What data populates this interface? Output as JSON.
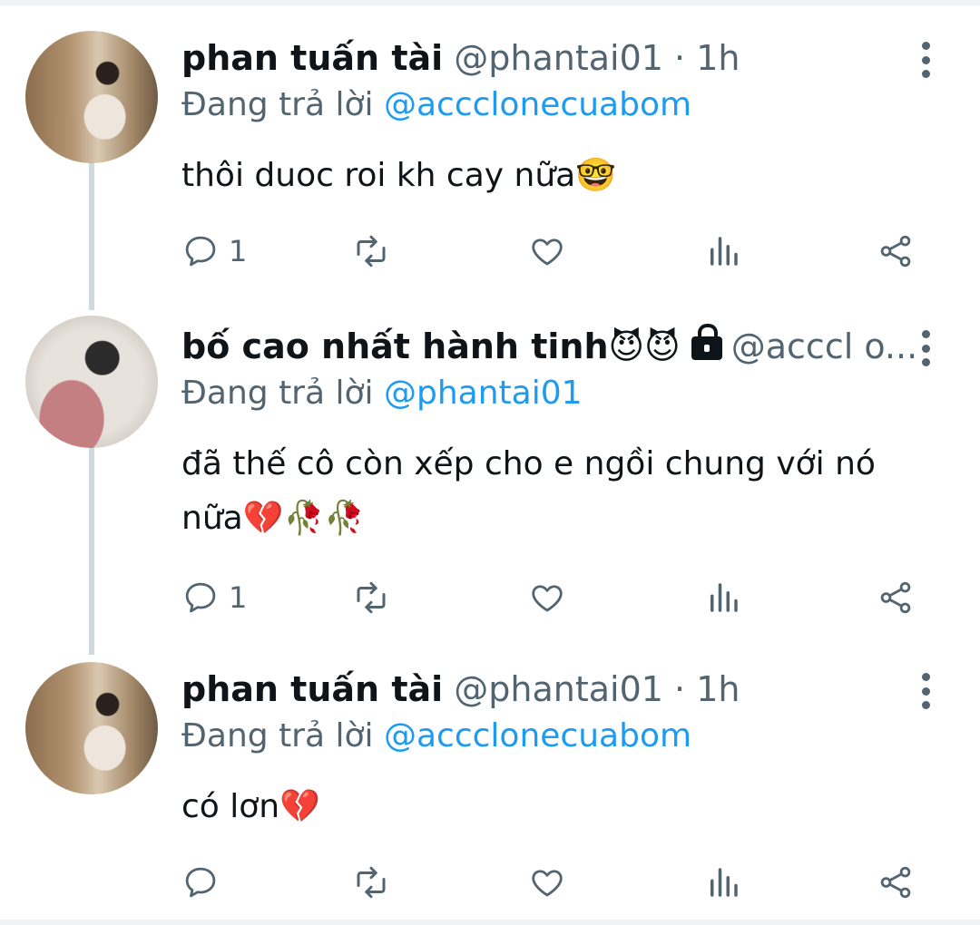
{
  "tweets": [
    {
      "name": "phan tuấn tài",
      "handle": "@phantai01",
      "dot": "·",
      "time": "1h",
      "reply_prefix": "Đang trả lời",
      "reply_to": "@accclonecuabom",
      "text": "thôi duoc roi kh cay nữa🤓",
      "reply_count": "1"
    },
    {
      "name": "bố cao nhất hành tinh😈😈",
      "handle": "@acccl o...",
      "reply_prefix": "Đang trả lời",
      "reply_to": "@phantai01",
      "text": "đã thế cô còn xếp cho e ngồi chung với nó nữa💔🥀🥀",
      "reply_count": "1"
    },
    {
      "name": "phan tuấn tài",
      "handle": "@phantai01",
      "dot": "·",
      "time": "1h",
      "reply_prefix": "Đang trả lời",
      "reply_to": "@accclonecuabom",
      "text": "có lơn💔",
      "reply_count": ""
    }
  ],
  "icons": {
    "reply": "reply-icon",
    "retweet": "retweet-icon",
    "like": "heart-icon",
    "views": "views-icon",
    "share": "share-icon",
    "more": "more-icon",
    "lock": "lock-icon"
  },
  "colors": {
    "link": "#1d9bf0",
    "secondary": "#536471",
    "text": "#0f1419",
    "thread_line": "#cfd9de"
  }
}
